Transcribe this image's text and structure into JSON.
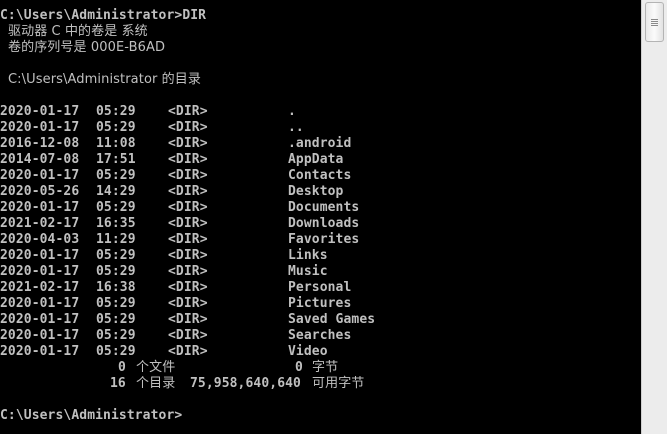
{
  "console": {
    "command_line": "C:\\Users\\Administrator>DIR",
    "volume_line": "驱动器 C 中的卷是 系统",
    "serial_line": "卷的序列号是 000E-B6AD",
    "dir_of_line": "C:\\Users\\Administrator 的目录",
    "entries": [
      {
        "date": "2020-01-17",
        "time": "05:29",
        "type": "<DIR>",
        "name": "."
      },
      {
        "date": "2020-01-17",
        "time": "05:29",
        "type": "<DIR>",
        "name": ".."
      },
      {
        "date": "2016-12-08",
        "time": "11:08",
        "type": "<DIR>",
        "name": ".android"
      },
      {
        "date": "2014-07-08",
        "time": "17:51",
        "type": "<DIR>",
        "name": "AppData"
      },
      {
        "date": "2020-01-17",
        "time": "05:29",
        "type": "<DIR>",
        "name": "Contacts"
      },
      {
        "date": "2020-05-26",
        "time": "14:29",
        "type": "<DIR>",
        "name": "Desktop"
      },
      {
        "date": "2020-01-17",
        "time": "05:29",
        "type": "<DIR>",
        "name": "Documents"
      },
      {
        "date": "2021-02-17",
        "time": "16:35",
        "type": "<DIR>",
        "name": "Downloads"
      },
      {
        "date": "2020-04-03",
        "time": "11:29",
        "type": "<DIR>",
        "name": "Favorites"
      },
      {
        "date": "2020-01-17",
        "time": "05:29",
        "type": "<DIR>",
        "name": "Links"
      },
      {
        "date": "2020-01-17",
        "time": "05:29",
        "type": "<DIR>",
        "name": "Music"
      },
      {
        "date": "2021-02-17",
        "time": "16:38",
        "type": "<DIR>",
        "name": "Personal"
      },
      {
        "date": "2020-01-17",
        "time": "05:29",
        "type": "<DIR>",
        "name": "Pictures"
      },
      {
        "date": "2020-01-17",
        "time": "05:29",
        "type": "<DIR>",
        "name": "Saved Games"
      },
      {
        "date": "2020-01-17",
        "time": "05:29",
        "type": "<DIR>",
        "name": "Searches"
      },
      {
        "date": "2020-01-17",
        "time": "05:29",
        "type": "<DIR>",
        "name": "Video"
      }
    ],
    "summary_files": {
      "count": "0",
      "label": "个文件",
      "bytes": "0",
      "unit": "字节"
    },
    "summary_dirs": {
      "count": "16",
      "label": "个目录",
      "bytes": "75,958,640,640",
      "unit": "可用字节"
    },
    "prompt_line": "C:\\Users\\Administrator>"
  },
  "colors": {
    "background": "#000000",
    "text": "#c0c0c0",
    "scrollbar": "#ececec"
  }
}
